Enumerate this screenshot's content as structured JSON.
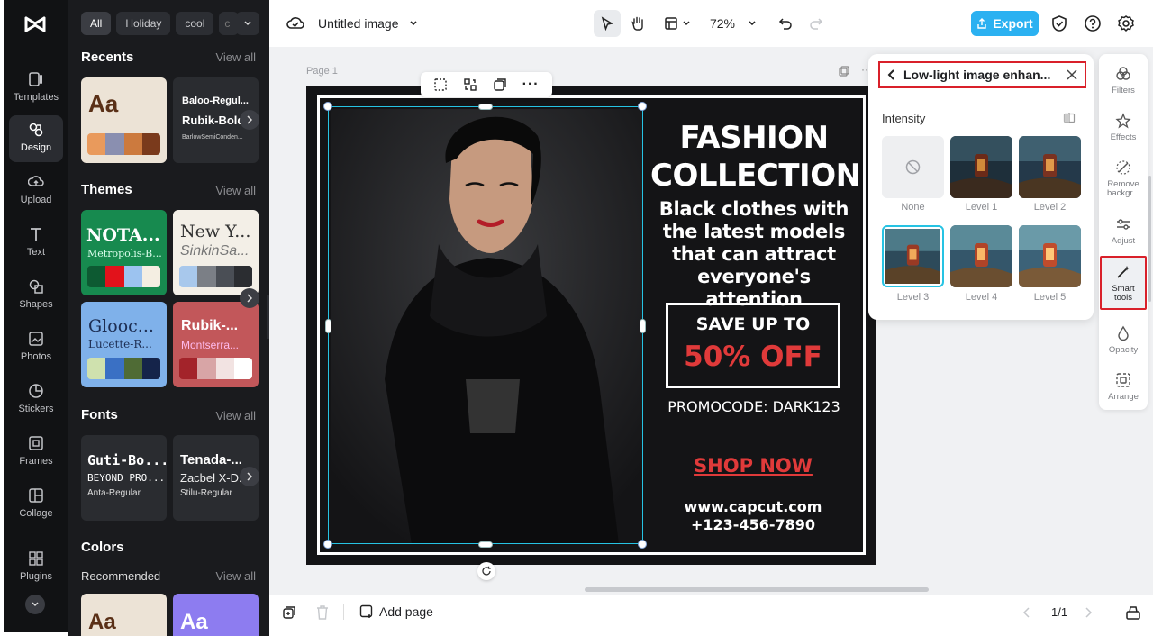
{
  "rail": {
    "items": [
      {
        "label": "Templates",
        "icon": "templates-icon"
      },
      {
        "label": "Design",
        "icon": "design-icon",
        "active": true
      },
      {
        "label": "Upload",
        "icon": "upload-icon"
      },
      {
        "label": "Text",
        "icon": "text-icon"
      },
      {
        "label": "Shapes",
        "icon": "shapes-icon"
      },
      {
        "label": "Photos",
        "icon": "photos-icon"
      },
      {
        "label": "Stickers",
        "icon": "stickers-icon"
      },
      {
        "label": "Frames",
        "icon": "frames-icon"
      },
      {
        "label": "Collage",
        "icon": "collage-icon"
      },
      {
        "label": "Plugins",
        "icon": "plugins-icon"
      }
    ]
  },
  "panel": {
    "chips": [
      "All",
      "Holiday",
      "cool",
      "c"
    ],
    "recents": {
      "title": "Recents",
      "view_all": "View all",
      "card1_text": "Aa",
      "card2_lines": [
        "Baloo-Regul...",
        "Rubik-Bold",
        "BarlowSemiConden..."
      ]
    },
    "themes": {
      "title": "Themes",
      "view_all": "View all",
      "items": [
        {
          "name": "NOTA...",
          "sub": "Metropolis-B..."
        },
        {
          "name": "New Y...",
          "sub": "SinkinSa..."
        },
        {
          "name": "Glooc...",
          "sub": "Lucette-R..."
        },
        {
          "name": "Rubik-...",
          "sub": "Montserra..."
        }
      ]
    },
    "fonts": {
      "title": "Fonts",
      "view_all": "View all",
      "items": [
        {
          "name": "Guti-Bo...",
          "line2": "BEYOND PRO...",
          "sub": "Anta-Regular"
        },
        {
          "name": "Tenada-...",
          "line2": "Zacbel X-D...",
          "sub": "Stilu-Regular"
        }
      ]
    },
    "colors": {
      "title": "Colors",
      "recommended": "Recommended",
      "view_all": "View all",
      "card1_text": "Aa",
      "card2_text": "Aa"
    }
  },
  "topbar": {
    "title": "Untitled image",
    "zoom": "72%",
    "export_label": "Export"
  },
  "canvas": {
    "page_label": "Page 1",
    "headline": "FASHION COLLECTION",
    "subline": "Black clothes with the latest models that can attract everyone's attention",
    "save_label": "SAVE UP TO",
    "off_label": "50% OFF",
    "promocode": "PROMOCODE: DARK123",
    "shop_now": "SHOP NOW",
    "website": "www.capcut.com",
    "phone": "+123-456-7890"
  },
  "enhance": {
    "title": "Low-light image enhan...",
    "intensity_label": "Intensity",
    "levels": [
      "None",
      "Level 1",
      "Level 2",
      "Level 3",
      "Level 4",
      "Level 5"
    ],
    "selected": "Level 3"
  },
  "right_tools": [
    {
      "label": "Filters",
      "icon": "filters-icon"
    },
    {
      "label": "Effects",
      "icon": "effects-icon"
    },
    {
      "label": "Remove backgr...",
      "icon": "remove-bg-icon"
    },
    {
      "label": "Adjust",
      "icon": "adjust-icon"
    },
    {
      "label": "Smart tools",
      "icon": "smart-tools-icon"
    },
    {
      "label": "Opacity",
      "icon": "opacity-icon"
    },
    {
      "label": "Arrange",
      "icon": "arrange-icon"
    }
  ],
  "bottombar": {
    "add_page": "Add page",
    "pager": "1/1"
  },
  "colors": {
    "accent": "#2bb1f1",
    "highlight": "#d9202a",
    "selection": "#26c3e3",
    "sale_red": "#e03a3a"
  }
}
